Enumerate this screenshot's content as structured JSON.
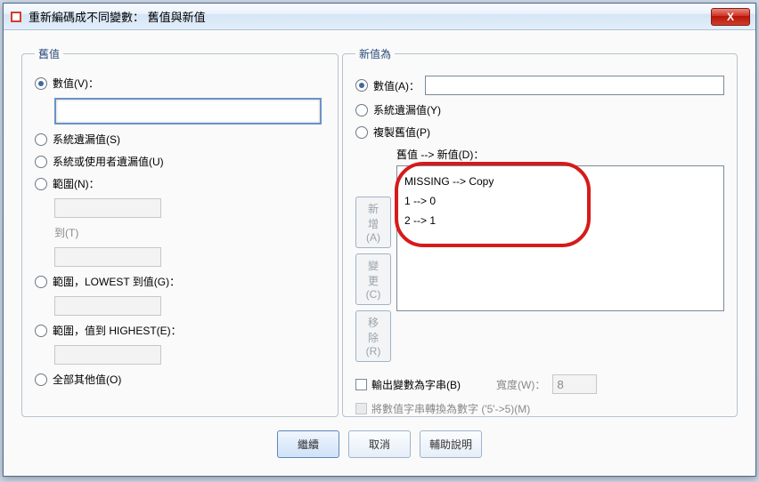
{
  "title": "重新編碼成不同變數： 舊值與新值",
  "close_x": "X",
  "groups": {
    "old": "舊值",
    "new": "新值為"
  },
  "old": {
    "value_label": "數值(V)：",
    "sysmissing_label": "系統遺漏值(S)",
    "sysusermissing_label": "系統或使用者遺漏值(U)",
    "range_label": "範圍(N)：",
    "thru_label": "到(T)",
    "lowest_label": "範圍，LOWEST 到值(G)：",
    "highest_label": "範圍，值到 HIGHEST(E)：",
    "else_label": "全部其他值(O)"
  },
  "new": {
    "value_label": "數值(A)：",
    "sysmissing_label": "系統遺漏值(Y)",
    "copy_label": "複製舊值(P)"
  },
  "mapping": {
    "header": "舊值 --> 新值(D)：",
    "items": [
      "MISSING --> Copy",
      "1 --> 0",
      "2 --> 1"
    ]
  },
  "sidebtn": {
    "add": "新增(A)",
    "change": "變更(C)",
    "remove": "移除(R)"
  },
  "output": {
    "string_label": "輸出變數為字串(B)",
    "width_label": "寬度(W)：",
    "width_value": "8",
    "convert_label": "將數值字串轉換為數字 ('5'->5)(M)"
  },
  "footer": {
    "continue": "繼續",
    "cancel": "取消",
    "help": "輔助說明"
  }
}
